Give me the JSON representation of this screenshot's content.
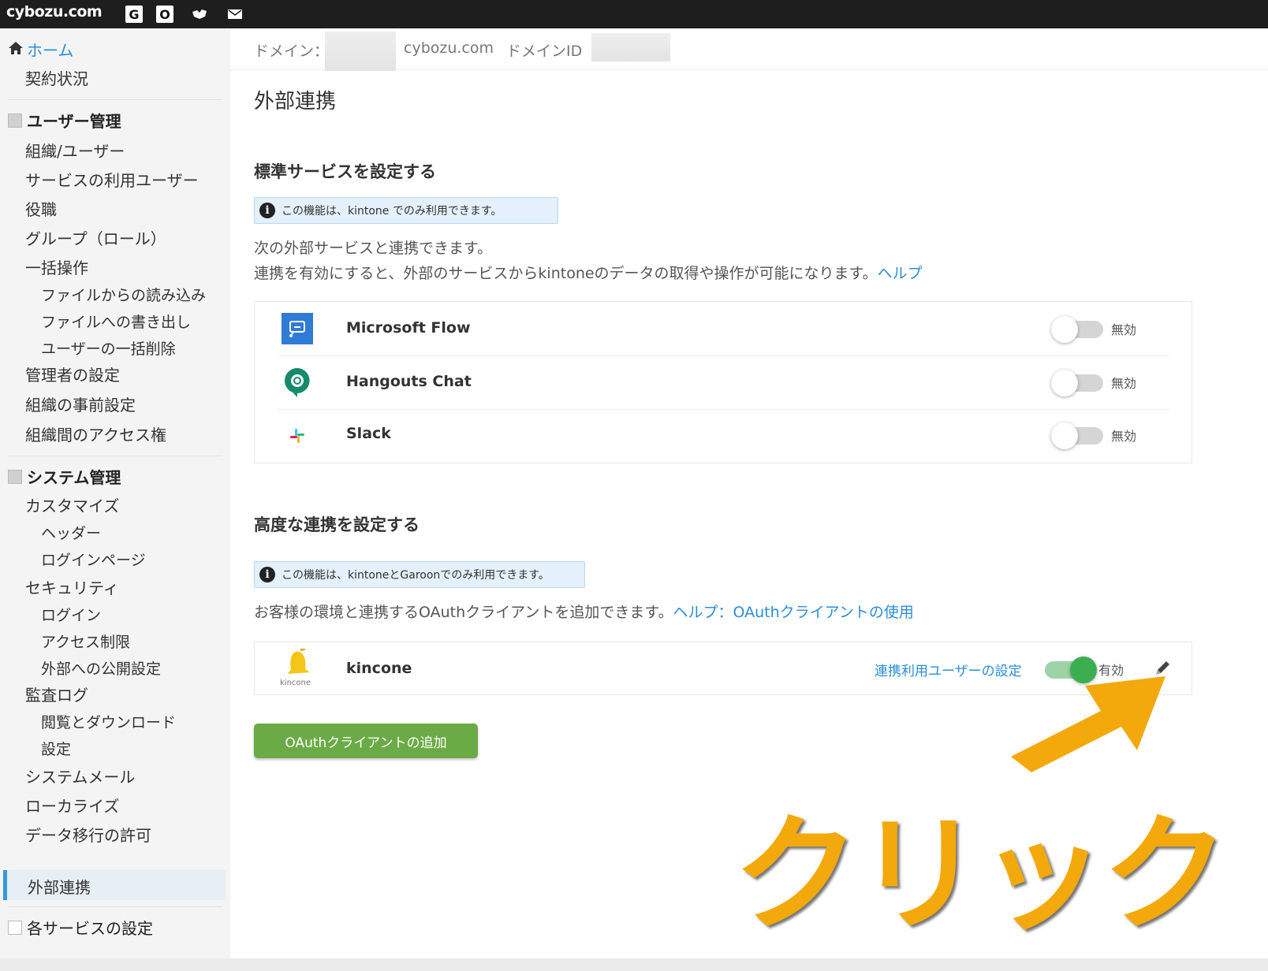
{
  "topbar": {
    "brand": "cybozu.com",
    "buttons": [
      "G",
      "O"
    ]
  },
  "sidebar": {
    "home": "ホーム",
    "contract": "契約状況",
    "user_mgmt": {
      "title": "ユーザー管理",
      "items": [
        "組織/ユーザー",
        "サービスの利用ユーザー",
        "役職",
        "グループ（ロール）",
        "一括操作"
      ],
      "bulk_sub": [
        "ファイルからの読み込み",
        "ファイルへの書き出し",
        "ユーザーの一括削除"
      ],
      "items2": [
        "管理者の設定",
        "組織の事前設定",
        "組織間のアクセス権"
      ]
    },
    "system_mgmt": {
      "title": "システム管理",
      "customize": "カスタマイズ",
      "customize_sub": [
        "ヘッダー",
        "ログインページ"
      ],
      "security": "セキュリティ",
      "security_sub": [
        "ログイン",
        "アクセス制限",
        "外部への公開設定"
      ],
      "audit": "監査ログ",
      "audit_sub": [
        "閲覧とダウンロード",
        "設定"
      ],
      "items": [
        "システムメール",
        "ローカライズ",
        "データ移行の許可",
        "外部連携"
      ]
    },
    "services": "各サービスの設定"
  },
  "domainbar": {
    "domain_label": "ドメイン：",
    "domain_suffix": "cybozu.com",
    "domain_id_label": "ドメインID"
  },
  "page": {
    "title": "外部連携",
    "standard": {
      "heading": "標準サービスを設定する",
      "info": "この機能は、kintone でのみ利用できます。",
      "desc1": "次の外部サービスと連携できます。",
      "desc2": "連携を有効にすると、外部のサービスからkintoneのデータの取得や操作が可能になります。",
      "help": "ヘルプ",
      "services": [
        {
          "name": "Microsoft Flow",
          "status": "無効",
          "icon": "microsoft-flow-icon"
        },
        {
          "name": "Hangouts Chat",
          "status": "無効",
          "icon": "hangouts-chat-icon"
        },
        {
          "name": "Slack",
          "status": "無効",
          "icon": "slack-icon"
        }
      ]
    },
    "advanced": {
      "heading": "高度な連携を設定する",
      "info": "この機能は、kintoneとGaroonでのみ利用できます。",
      "desc": "お客様の環境と連携するOAuthクライアントを追加できます。",
      "help": "ヘルプ：OAuthクライアントの使用",
      "client": {
        "name": "kincone",
        "logo_text": "kincone",
        "user_settings_link": "連携利用ユーザーの設定",
        "status": "有効",
        "enabled": true
      },
      "add_button": "OAuthクライアントの追加"
    }
  },
  "annotation": {
    "text": "クリック",
    "color": "#f3a90c"
  }
}
